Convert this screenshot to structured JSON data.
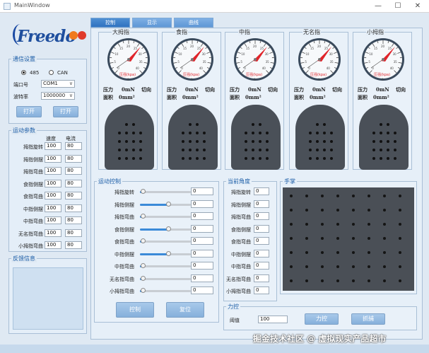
{
  "window": {
    "title": "MainWindow",
    "minimize": "—",
    "maximize": "☐",
    "close": "✕"
  },
  "logo": {
    "text": "Freedo"
  },
  "comm": {
    "title": "通信设置",
    "radio_485": "485",
    "radio_can": "CAN",
    "port_label": "端口号",
    "port_value": "COM1",
    "baud_label": "波特率",
    "baud_value": "1000000",
    "open_label": "打开",
    "open2_label": "打开"
  },
  "motion": {
    "title": "运动参数",
    "col_speed": "速度",
    "col_current": "电流",
    "rows": [
      {
        "label": "拇指旋转",
        "speed": "100",
        "current": "80"
      },
      {
        "label": "拇指侧摆",
        "speed": "100",
        "current": "80"
      },
      {
        "label": "拇指弯曲",
        "speed": "100",
        "current": "80"
      },
      {
        "label": "食指侧摆",
        "speed": "100",
        "current": "80"
      },
      {
        "label": "食指弯曲",
        "speed": "100",
        "current": "80"
      },
      {
        "label": "中指侧摆",
        "speed": "100",
        "current": "80"
      },
      {
        "label": "中指弯曲",
        "speed": "100",
        "current": "80"
      },
      {
        "label": "无名指弯曲",
        "speed": "100",
        "current": "80"
      },
      {
        "label": "小拇指弯曲",
        "speed": "100",
        "current": "80"
      }
    ]
  },
  "feedback": {
    "title": "反馈信息"
  },
  "tabs": [
    "控制",
    "显示",
    "曲线"
  ],
  "fingers": [
    {
      "name": "大拇指",
      "unit": "压强(kpa)",
      "pressure_label": "压力",
      "pressure": "0mN",
      "tangent": "切向",
      "area_label": "面积",
      "area": "0mm²"
    },
    {
      "name": "食指",
      "unit": "压强(kpa)",
      "pressure_label": "压力",
      "pressure": "0mN",
      "tangent": "切向",
      "area_label": "面积",
      "area": "0mm²"
    },
    {
      "name": "中指",
      "unit": "压强(kpa)",
      "pressure_label": "压力",
      "pressure": "0mN",
      "tangent": "切向",
      "area_label": "面积",
      "area": "0mm²"
    },
    {
      "name": "无名指",
      "unit": "压强(kpa)",
      "pressure_label": "压力",
      "pressure": "0mN",
      "tangent": "切向",
      "area_label": "面积",
      "area": "0mm²"
    },
    {
      "name": "小拇指",
      "unit": "压强(kpa)",
      "pressure_label": "压力",
      "pressure": "0mN",
      "tangent": "切向",
      "area_label": "面积",
      "area": "0mm²"
    }
  ],
  "gauge": {
    "ticks": [
      "0",
      "5",
      "10",
      "15",
      "20",
      "25",
      "30",
      "35",
      "40"
    ],
    "value": "0"
  },
  "motion_control": {
    "title": "运动控制",
    "rows": [
      {
        "label": "拇指旋转",
        "value": "0",
        "level": 0.05
      },
      {
        "label": "拇指侧摆",
        "value": "0",
        "level": 0.55
      },
      {
        "label": "拇指弯曲",
        "value": "0",
        "level": 0.05
      },
      {
        "label": "食指侧摆",
        "value": "0",
        "level": 0.55
      },
      {
        "label": "食指弯曲",
        "value": "0",
        "level": 0.05
      },
      {
        "label": "中指侧摆",
        "value": "0",
        "level": 0.55
      },
      {
        "label": "中指弯曲",
        "value": "0",
        "level": 0.05
      },
      {
        "label": "无名指弯曲",
        "value": "0",
        "level": 0.05
      },
      {
        "label": "小拇指弯曲",
        "value": "0",
        "level": 0.05
      }
    ],
    "control_label": "控制",
    "reset_label": "复位"
  },
  "current_angle": {
    "title": "当前角度",
    "rows": [
      {
        "label": "拇指旋转",
        "value": "0"
      },
      {
        "label": "拇指侧摆",
        "value": "0"
      },
      {
        "label": "拇指弯曲",
        "value": "0"
      },
      {
        "label": "食指侧摆",
        "value": "0"
      },
      {
        "label": "食指弯曲",
        "value": "0"
      },
      {
        "label": "中指侧摆",
        "value": "0"
      },
      {
        "label": "中指弯曲",
        "value": "0"
      },
      {
        "label": "无名指弯曲",
        "value": "0"
      },
      {
        "label": "小拇指弯曲",
        "value": "0"
      }
    ]
  },
  "palm": {
    "title": "手掌"
  },
  "force": {
    "title": "力控",
    "threshold_label": "阈值",
    "threshold_value": "100",
    "force_label": "力控",
    "grab_label": "抓捕"
  },
  "watermark": "掘金技术社区 @ 虚拟现实产品超市",
  "colors": {
    "accent": "#2f72c0",
    "needle": "#e0242a",
    "pad": "#4a5058"
  }
}
